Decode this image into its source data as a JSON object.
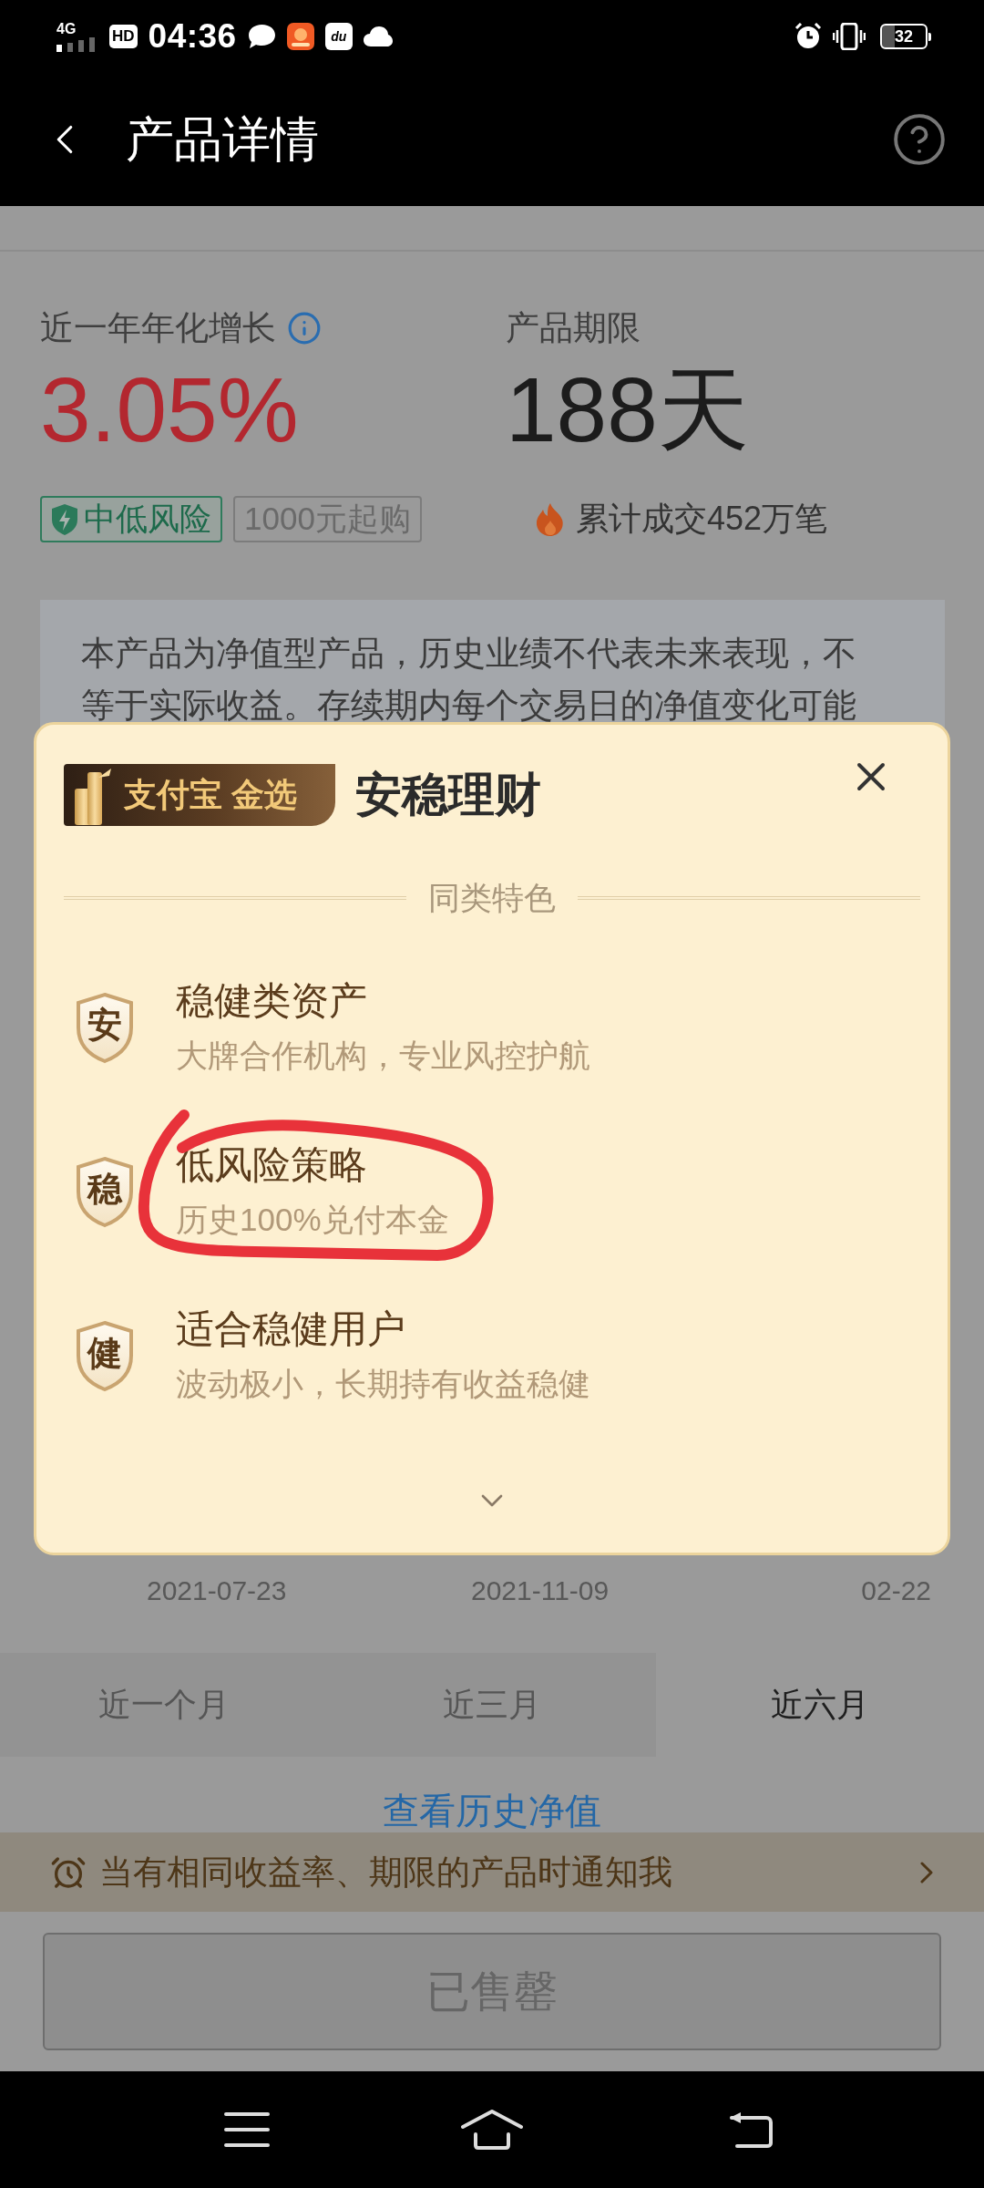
{
  "status_bar": {
    "network": "4G",
    "hd_badge": "HD",
    "time": "04:36",
    "app_badge": "du",
    "battery": "32"
  },
  "header": {
    "title": "产品详情"
  },
  "summary": {
    "yield_label": "近一年年化增长",
    "yield_value": "3.05%",
    "term_label": "产品期限",
    "term_value": "188天",
    "tags": [
      {
        "kind": "risk",
        "label": "中低风险"
      },
      {
        "kind": "plain",
        "label": "1000元起购"
      }
    ],
    "sales": "累计成交452万笔"
  },
  "disclaimer": "本产品为净值型产品，历史业绩不代表未来表现，不等于实际收益。存续期内每个交易日的净值变化可能",
  "popup": {
    "brand": "支付宝 金选",
    "title": "安稳理财",
    "section": "同类特色",
    "features": [
      {
        "badge": "安",
        "title": "稳健类资产",
        "subtitle": "大牌合作机构，专业风控护航",
        "circled": false
      },
      {
        "badge": "稳",
        "title": "低风险策略",
        "subtitle": "历史100%兑付本金",
        "circled": true
      },
      {
        "badge": "健",
        "title": "适合稳健用户",
        "subtitle": "波动极小，长期持有收益稳健",
        "circled": false
      }
    ]
  },
  "chart_axis": {
    "dates": [
      "2021-07-23",
      "2021-11-09",
      "02-22"
    ]
  },
  "periods": [
    {
      "label": "近一个月",
      "selected": false
    },
    {
      "label": "近三月",
      "selected": false
    },
    {
      "label": "近六月",
      "selected": true
    }
  ],
  "history_link": "查看历史净值",
  "notify": {
    "text": "当有相同收益率、期限的产品时通知我"
  },
  "buy_button": {
    "label": "已售罄",
    "disabled": true
  }
}
